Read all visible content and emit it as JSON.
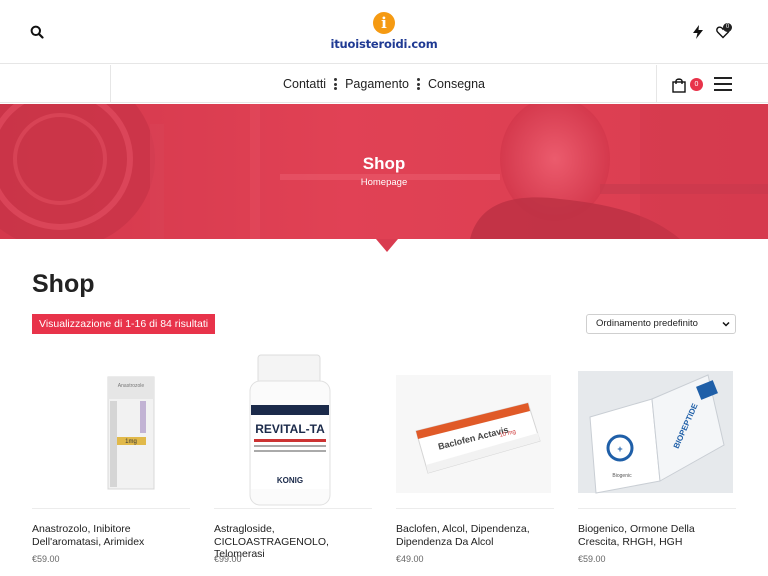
{
  "header": {
    "logo_text": "ituoisteroidi.com",
    "logo_glyph": "i",
    "icons": {
      "search": "search-icon",
      "flash": "bolt-icon",
      "wishlist": "heart-icon"
    },
    "wishlist_count": "0"
  },
  "nav": {
    "items": [
      {
        "label": "Contatti"
      },
      {
        "label": "Pagamento"
      },
      {
        "label": "Consegna"
      }
    ],
    "cart_count": "0",
    "icons": {
      "cart": "shopping-bag-icon",
      "menu": "hamburger-menu-icon"
    }
  },
  "hero": {
    "title": "Shop",
    "breadcrumb": "Homepage"
  },
  "shop": {
    "title": "Shop",
    "result_count": "Visualizzazione di 1-16 di 84 risultati",
    "ordering": "Ordinamento predefinito"
  },
  "products": [
    {
      "name": "Anastrozolo, Inibitore Dell'aromatasi, Arimidex",
      "price": "€59.00",
      "image_label": "1mg",
      "image_text": "Anastrozole"
    },
    {
      "name": "Astragloside, CICLOASTRAGENOLO, Telomerasi",
      "price": "€99.00",
      "image_label": "REVITAL-TA",
      "image_text": "KONIG"
    },
    {
      "name": "Baclofen, Alcol, Dipendenza, Dipendenza Da Alcol",
      "price": "€49.00",
      "image_label": "Baclofen Actavis",
      "image_text": "10 mg"
    },
    {
      "name": "Biogenico, Ormone Della Crescita, RHGH, HGH",
      "price": "€59.00",
      "image_label": "BIOPEPTIDE",
      "image_text": "Biogenic"
    }
  ],
  "colors": {
    "accent": "#e8334a",
    "logo_blue": "#1f3a93",
    "logo_orange": "#f59a12"
  }
}
